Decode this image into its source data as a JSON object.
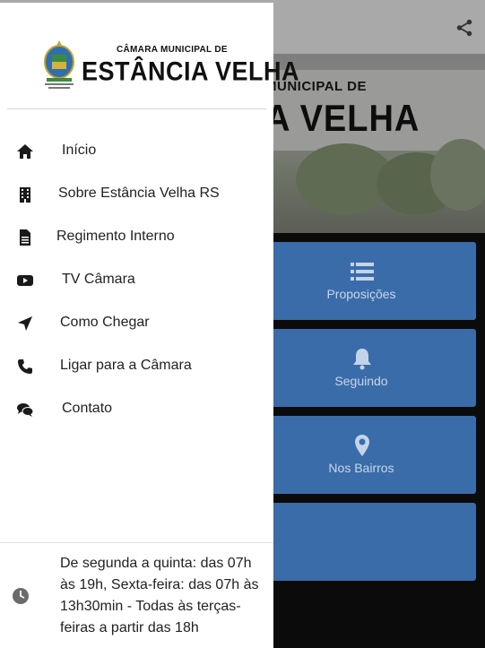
{
  "background": {
    "hero_small_text": "MUNICIPAL DE",
    "hero_big_text": "A VELHA",
    "tiles": [
      {
        "label": "Proposições",
        "icon": "list-icon"
      },
      {
        "label": "Seguindo",
        "icon": "bell-icon"
      },
      {
        "label": "Nos Bairros",
        "icon": "map-marker-icon"
      },
      {
        "label": "",
        "icon": ""
      }
    ],
    "colors": {
      "tile": "#3a6ca9",
      "topbar": "#a9a9a9"
    }
  },
  "drawer": {
    "logo_small": "CÂMARA MUNICIPAL DE",
    "logo_big": "ESTÂNCIA VELHA",
    "menu": [
      {
        "label": "Início",
        "icon": "home-icon"
      },
      {
        "label": "Sobre Estância Velha RS",
        "icon": "building-icon"
      },
      {
        "label": "Regimento Interno",
        "icon": "document-icon"
      },
      {
        "label": "TV Câmara",
        "icon": "youtube-icon"
      },
      {
        "label": "Como Chegar",
        "icon": "location-arrow-icon"
      },
      {
        "label": "Ligar para a Câmara",
        "icon": "phone-icon"
      },
      {
        "label": "Contato",
        "icon": "comments-icon"
      }
    ],
    "hours": "De segunda a quinta: das 07h às 19h, Sexta-feira: das 07h às 13h30min - Todas às terças-feiras a partir das 18h"
  }
}
